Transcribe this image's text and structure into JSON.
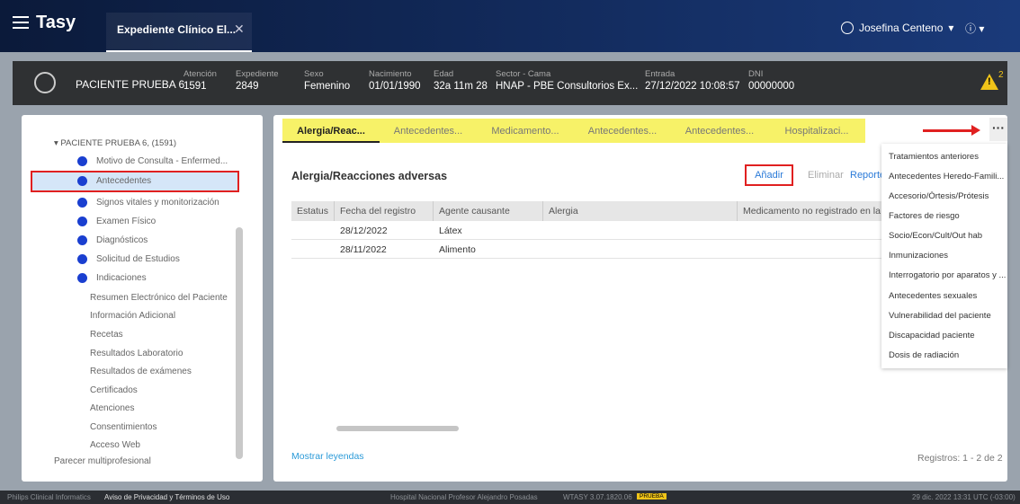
{
  "app": {
    "title": "Tasy",
    "tab_label": "Expediente Clínico El...",
    "tab_close": "✕"
  },
  "user": {
    "name": "Josefina Centeno",
    "menu_caret": "▾",
    "info": "ⓘ ▾"
  },
  "patient": {
    "name": "PACIENTE PRUEBA 6",
    "fields": [
      {
        "label": "Atención",
        "value": "1591"
      },
      {
        "label": "Expediente",
        "value": "2849"
      },
      {
        "label": "Sexo",
        "value": "Femenino"
      },
      {
        "label": "Nacimiento",
        "value": "01/01/1990"
      },
      {
        "label": "Edad",
        "value": "32a 11m 28"
      },
      {
        "label": "Sector - Cama",
        "value": "HNAP - PBE Consultorios Ex..."
      },
      {
        "label": "Entrada",
        "value": "27/12/2022 10:08:57"
      },
      {
        "label": "DNI",
        "value": "00000000"
      }
    ],
    "alert_count": "2"
  },
  "tree": {
    "root": "▾ PACIENTE PRUEBA 6, (1591)",
    "dot_items": [
      "Motivo de Consulta - Enfermed...",
      "Antecedentes",
      "Signos vitales y monitorización",
      "Examen Físico",
      "Diagnósticos",
      "Solicitud de Estudios",
      "Indicaciones"
    ],
    "plain_items": [
      "Resumen Electrónico del Paciente",
      "Información Adicional",
      "Recetas",
      "Resultados Laboratorio",
      "Resultados de exámenes",
      "Certificados",
      "Atenciones",
      "Consentimientos",
      "Acceso Web"
    ],
    "top_item": "Parecer multiprofesional"
  },
  "tabs": [
    "Alergia/Reac...",
    "Antecedentes...",
    "Medicamento...",
    "Antecedentes...",
    "Antecedentes...",
    "Hospitalizaci..."
  ],
  "more_label": "···",
  "section": {
    "title": "Alergia/Reacciones adversas",
    "add": "Añadir",
    "delete": "Eliminar",
    "report": "Reportes"
  },
  "table": {
    "headers": [
      "Estatus",
      "Fecha del registro",
      "Agente causante",
      "Alergia",
      "Medicamento no registrado en la instit"
    ],
    "rows": [
      [
        "",
        "28/12/2022",
        "Látex",
        "",
        ""
      ],
      [
        "",
        "28/11/2022",
        "Alimento",
        "",
        ""
      ]
    ]
  },
  "legend_link": "Mostrar leyendas",
  "records": "Registros:  1 - 2 de  2",
  "dropdown": [
    "Tratamientos anteriores",
    "Antecedentes Heredo-Famili...",
    "Accesorio/Órtesis/Prótesis",
    "Factores de riesgo",
    "Socio/Econ/Cult/Out hab",
    "Inmunizaciones",
    "Interrogatorio por aparatos y ...",
    "Antecedentes sexuales",
    "Vulnerabilidad del paciente",
    "Discapacidad paciente",
    "Dosis de radiación"
  ],
  "footer": {
    "left": "Philips Clinical Informatics",
    "privacy": "Aviso de Privacidad y Términos de Uso",
    "hospital": "Hospital Nacional Profesor Alejandro Posadas",
    "version": "WTASY 3.07.1820.06",
    "badge": "PRUEBA",
    "datetime": "29 dic. 2022  13:31  UTC (-03:00)"
  }
}
